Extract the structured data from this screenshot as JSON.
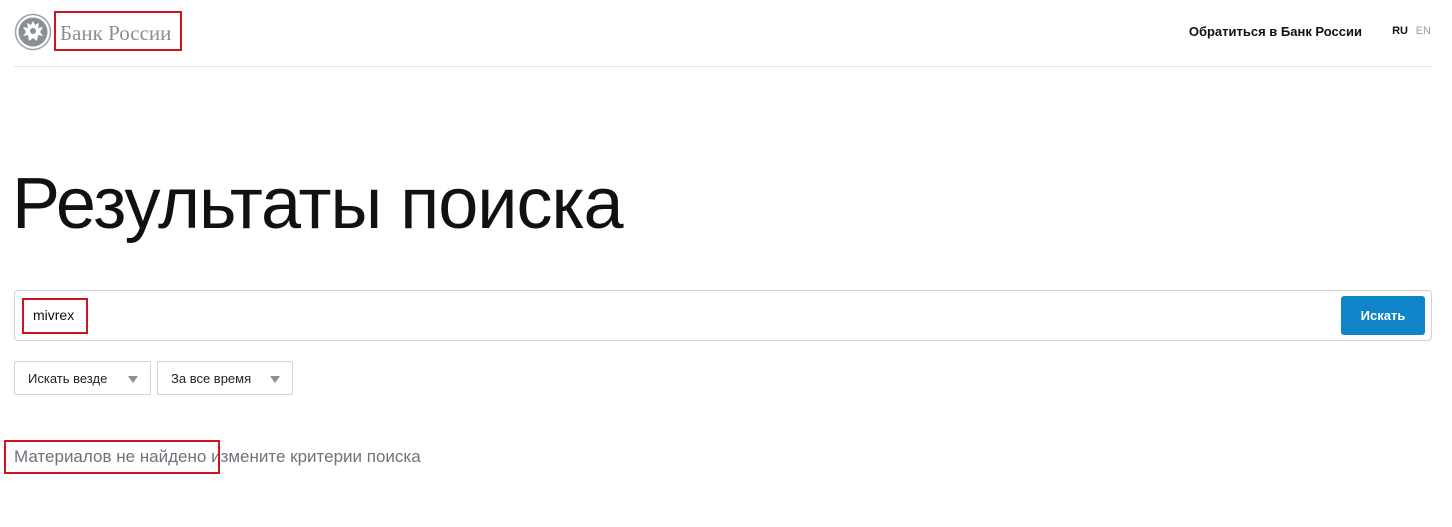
{
  "header": {
    "logo_text": "Банк России",
    "contact_link": "Обратиться в Банк России",
    "languages": [
      {
        "label": "RU",
        "active": true
      },
      {
        "label": "EN",
        "active": false
      }
    ]
  },
  "page": {
    "title": "Результаты поиска"
  },
  "search": {
    "query": "mivrex",
    "button_label": "Искать"
  },
  "filters": {
    "scope": {
      "selected": "Искать везде"
    },
    "period": {
      "selected": "За все время"
    }
  },
  "result": {
    "message_main": "Материалов не найдено",
    "message_hint": "измените критерии поиска"
  },
  "colors": {
    "accent": "#0f84c8",
    "highlight_border": "#d0141c",
    "muted_text": "#6d737a"
  },
  "icons": [
    "bank-emblem-icon",
    "caret-down-icon"
  ]
}
